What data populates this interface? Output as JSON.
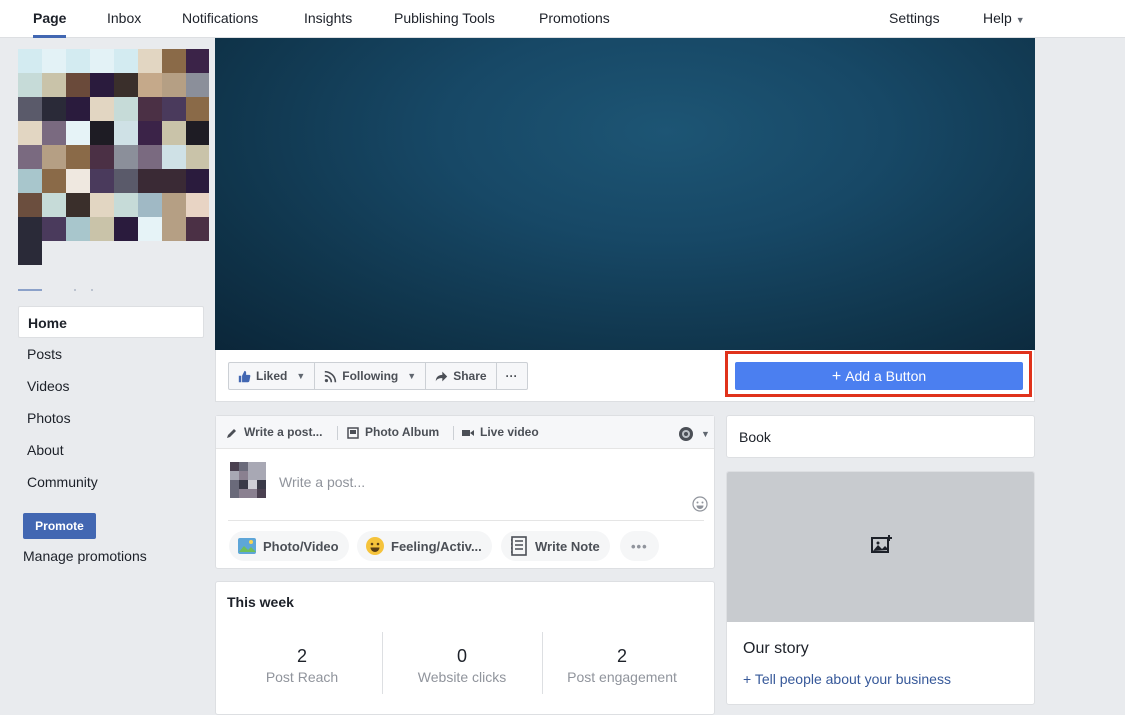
{
  "topnav": {
    "items": [
      "Page",
      "Inbox",
      "Notifications",
      "Insights",
      "Publishing Tools",
      "Promotions"
    ],
    "settings": "Settings",
    "help": "Help"
  },
  "leftnav": {
    "items": [
      "Home",
      "Posts",
      "Videos",
      "Photos",
      "About",
      "Community"
    ],
    "promote": "Promote",
    "manage_promotions": "Manage promotions"
  },
  "actions": {
    "liked": "Liked",
    "following": "Following",
    "share": "Share",
    "more": "···",
    "add_button": "Add a Button"
  },
  "composer": {
    "tabs": [
      "Write a post...",
      "Photo Album",
      "Live video"
    ],
    "placeholder": "Write a post...",
    "pills": [
      "Photo/Video",
      "Feeling/Activ...",
      "Write Note"
    ],
    "more": "•••"
  },
  "right": {
    "book": "Book",
    "story_title": "Our story",
    "story_link": "+ Tell people about your business"
  },
  "this_week": {
    "title": "This week",
    "stats": [
      {
        "value": "2",
        "label": "Post Reach"
      },
      {
        "value": "0",
        "label": "Website clicks"
      },
      {
        "value": "2",
        "label": "Post engagement"
      }
    ]
  },
  "colors": {
    "brand": "#4267b2",
    "add_button": "#4b7ff0",
    "highlight": "#e0321b"
  }
}
